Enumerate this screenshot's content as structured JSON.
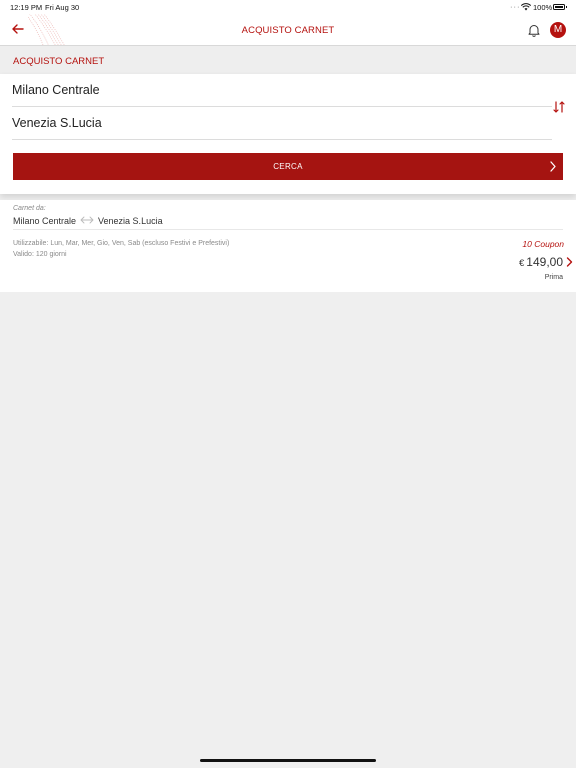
{
  "status_bar": {
    "time": "12:19 PM",
    "date": "Fri Aug 30",
    "battery": "100%"
  },
  "header": {
    "title": "ACQUISTO CARNET",
    "avatar_initial": "M"
  },
  "section": {
    "title": "ACQUISTO CARNET"
  },
  "search": {
    "from": "Milano Centrale",
    "to": "Venezia S.Lucia",
    "button_label": "CERCA"
  },
  "result": {
    "label": "Carnet da:",
    "from": "Milano Centrale",
    "to": "Venezia S.Lucia",
    "usable": "Utilizzabile: Lun, Mar, Mer, Gio, Ven, Sab (escluso Festivi e Prefestivi)",
    "validity": "Valido: 120 giorni",
    "coupons": "10 Coupon",
    "currency": "€",
    "price": "149,00",
    "fare_class": "Prima"
  },
  "colors": {
    "accent": "#b5120f",
    "button": "#a51411",
    "background": "#efefef"
  },
  "icons": [
    "back-arrow-icon",
    "bell-icon",
    "swap-icon",
    "chevron-right-icon",
    "bidirectional-arrow-icon",
    "wifi-icon",
    "battery-icon"
  ]
}
